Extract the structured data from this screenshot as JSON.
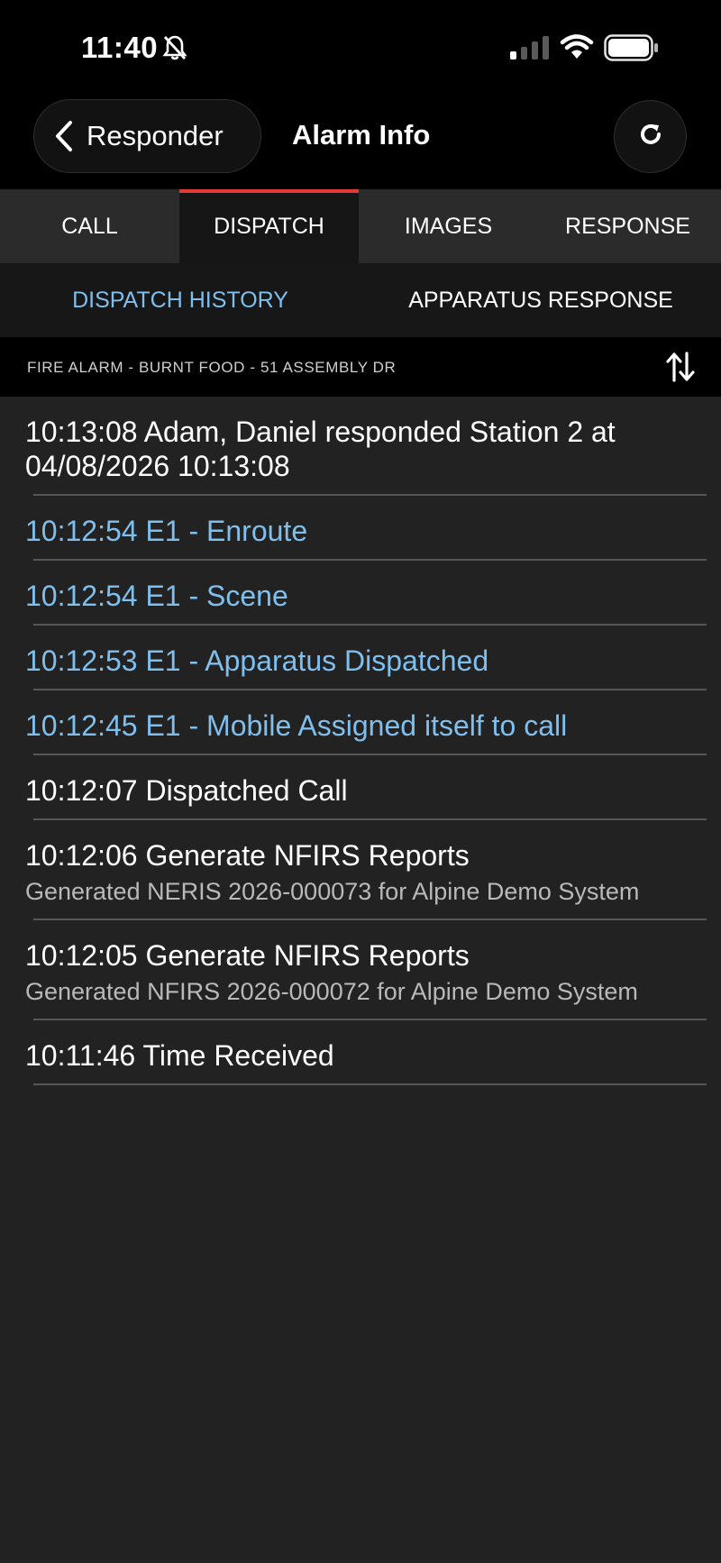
{
  "status_bar": {
    "time": "11:40",
    "icons": [
      "bell-slash-icon",
      "cellular-signal-icon",
      "wifi-icon",
      "battery-icon"
    ]
  },
  "nav": {
    "back_label": "Responder",
    "title": "Alarm Info",
    "refresh_icon": "refresh-icon"
  },
  "tabs": [
    {
      "label": "CALL"
    },
    {
      "label": "DISPATCH"
    },
    {
      "label": "IMAGES"
    },
    {
      "label": "RESPONSE"
    }
  ],
  "active_tab": "DISPATCH",
  "subtabs": [
    {
      "label": "DISPATCH HISTORY"
    },
    {
      "label": "APPARATUS RESPONSE"
    }
  ],
  "active_subtab": "DISPATCH HISTORY",
  "call_header": {
    "text": "FIRE ALARM - BURNT FOOD - 51 ASSEMBLY DR",
    "sort_icon": "sort-arrows-icon"
  },
  "history": [
    {
      "title": "10:13:08 Adam, Daniel responded Station 2 at 04/08/2026 10:13:08",
      "detail": "",
      "highlight": false
    },
    {
      "title": "10:12:54 E1 - Enroute",
      "detail": "",
      "highlight": true
    },
    {
      "title": "10:12:54 E1 - Scene",
      "detail": "",
      "highlight": true
    },
    {
      "title": "10:12:53 E1 - Apparatus Dispatched",
      "detail": "",
      "highlight": true
    },
    {
      "title": "10:12:45 E1 - Mobile Assigned itself to call",
      "detail": "",
      "highlight": true
    },
    {
      "title": "10:12:07 Dispatched Call",
      "detail": "",
      "highlight": false
    },
    {
      "title": "10:12:06 Generate NFIRS Reports",
      "detail": "Generated NERIS 2026-000073 for Alpine Demo System",
      "highlight": false
    },
    {
      "title": "10:12:05 Generate NFIRS Reports",
      "detail": "Generated NFIRS 2026-000072 for Alpine Demo System",
      "highlight": false
    },
    {
      "title": "10:11:46 Time Received",
      "detail": "",
      "highlight": false
    }
  ],
  "colors": {
    "accent_red": "#e53935",
    "link_blue": "#7fbfee",
    "background": "#222222"
  }
}
